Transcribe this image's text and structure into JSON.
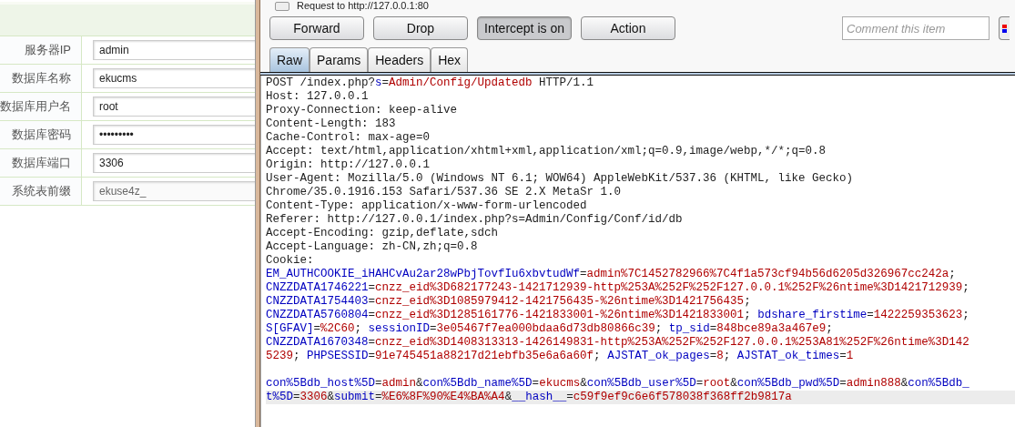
{
  "form": {
    "rows": [
      {
        "label": "服务器IP",
        "value": "admin",
        "disabled": false
      },
      {
        "label": "数据库名称",
        "value": "ekucms",
        "disabled": false
      },
      {
        "label": "数据库用户名",
        "value": "root",
        "disabled": false
      },
      {
        "label": "数据库密码",
        "value": "•••••••••",
        "disabled": false
      },
      {
        "label": "数据库端口",
        "value": "3306",
        "disabled": false
      },
      {
        "label": "系统表前缀",
        "value": "ekuse4z_",
        "disabled": true
      }
    ]
  },
  "proxy": {
    "title": "Request to http://127.0.0.1:80",
    "buttons": [
      {
        "label": "Forward",
        "pressed": false
      },
      {
        "label": "Drop",
        "pressed": false
      },
      {
        "label": "Intercept is on",
        "pressed": true
      },
      {
        "label": "Action",
        "pressed": false
      }
    ],
    "comment": {
      "placeholder": "Comment this item"
    },
    "tabs": [
      {
        "label": "Raw",
        "selected": true
      },
      {
        "label": "Params",
        "selected": false
      },
      {
        "label": "Headers",
        "selected": false
      },
      {
        "label": "Hex",
        "selected": false
      }
    ],
    "lines": [
      {
        "highlighted": false,
        "segments": [
          {
            "text": "POST /index.php?",
            "kind": "plain"
          },
          {
            "text": "s",
            "kind": "key"
          },
          {
            "text": "=",
            "kind": "plain"
          },
          {
            "text": "Admin/Config/Updatedb",
            "kind": "value"
          },
          {
            "text": " HTTP/1.1",
            "kind": "plain"
          }
        ]
      },
      {
        "highlighted": false,
        "segments": [
          {
            "text": "Host: 127.0.0.1",
            "kind": "plain"
          }
        ]
      },
      {
        "highlighted": false,
        "segments": [
          {
            "text": "Proxy-Connection: keep-alive",
            "kind": "plain"
          }
        ]
      },
      {
        "highlighted": false,
        "segments": [
          {
            "text": "Content-Length: 183",
            "kind": "plain"
          }
        ]
      },
      {
        "highlighted": false,
        "segments": [
          {
            "text": "Cache-Control: max-age=0",
            "kind": "plain"
          }
        ]
      },
      {
        "highlighted": false,
        "segments": [
          {
            "text": "Accept: text/html,application/xhtml+xml,application/xml;q=0.9,image/webp,*/*;q=0.8",
            "kind": "plain"
          }
        ]
      },
      {
        "highlighted": false,
        "segments": [
          {
            "text": "Origin: http://127.0.0.1",
            "kind": "plain"
          }
        ]
      },
      {
        "highlighted": false,
        "segments": [
          {
            "text": "User-Agent: Mozilla/5.0 (Windows NT 6.1; WOW64) AppleWebKit/537.36 (KHTML, like Gecko)",
            "kind": "plain"
          }
        ]
      },
      {
        "highlighted": false,
        "segments": [
          {
            "text": "Chrome/35.0.1916.153 Safari/537.36 SE 2.X MetaSr 1.0",
            "kind": "plain"
          }
        ]
      },
      {
        "highlighted": false,
        "segments": [
          {
            "text": "Content-Type: application/x-www-form-urlencoded",
            "kind": "plain"
          }
        ]
      },
      {
        "highlighted": false,
        "segments": [
          {
            "text": "Referer: http://127.0.0.1/index.php?s=Admin/Config/Conf/id/db",
            "kind": "plain"
          }
        ]
      },
      {
        "highlighted": false,
        "segments": [
          {
            "text": "Accept-Encoding: gzip,deflate,sdch",
            "kind": "plain"
          }
        ]
      },
      {
        "highlighted": false,
        "segments": [
          {
            "text": "Accept-Language: zh-CN,zh;q=0.8",
            "kind": "plain"
          }
        ]
      },
      {
        "highlighted": false,
        "segments": [
          {
            "text": "Cookie:",
            "kind": "plain"
          }
        ]
      },
      {
        "highlighted": false,
        "segments": [
          {
            "text": "EM_AUTHCOOKIE_iHAHCvAu2ar28wPbjTovfIu6xbvtudWf",
            "kind": "key"
          },
          {
            "text": "=",
            "kind": "plain"
          },
          {
            "text": "admin%7C1452782966%7C4f1a573cf94b56d6205d326967cc242a",
            "kind": "value"
          },
          {
            "text": ";",
            "kind": "plain"
          }
        ]
      },
      {
        "highlighted": false,
        "segments": [
          {
            "text": "CNZZDATA1746221",
            "kind": "key"
          },
          {
            "text": "=",
            "kind": "plain"
          },
          {
            "text": "cnzz_eid%3D682177243-1421712939-http%253A%252F%252F127.0.0.1%252F%26ntime%3D1421712939",
            "kind": "value"
          },
          {
            "text": ";",
            "kind": "plain"
          }
        ]
      },
      {
        "highlighted": false,
        "segments": [
          {
            "text": "CNZZDATA1754403",
            "kind": "key"
          },
          {
            "text": "=",
            "kind": "plain"
          },
          {
            "text": "cnzz_eid%3D1085979412-1421756435-%26ntime%3D1421756435",
            "kind": "value"
          },
          {
            "text": ";",
            "kind": "plain"
          }
        ]
      },
      {
        "highlighted": false,
        "segments": [
          {
            "text": "CNZZDATA5760804",
            "kind": "key"
          },
          {
            "text": "=",
            "kind": "plain"
          },
          {
            "text": "cnzz_eid%3D1285161776-1421833001-%26ntime%3D1421833001",
            "kind": "value"
          },
          {
            "text": "; ",
            "kind": "plain"
          },
          {
            "text": "bdshare_firstime",
            "kind": "key"
          },
          {
            "text": "=",
            "kind": "plain"
          },
          {
            "text": "1422259353623",
            "kind": "value"
          },
          {
            "text": ";",
            "kind": "plain"
          }
        ]
      },
      {
        "highlighted": false,
        "segments": [
          {
            "text": "S[GFAV]",
            "kind": "key"
          },
          {
            "text": "=",
            "kind": "plain"
          },
          {
            "text": "%2C60",
            "kind": "value"
          },
          {
            "text": "; ",
            "kind": "plain"
          },
          {
            "text": "sessionID",
            "kind": "key"
          },
          {
            "text": "=",
            "kind": "plain"
          },
          {
            "text": "3e05467f7ea000bdaa6d73db80866c39",
            "kind": "value"
          },
          {
            "text": "; ",
            "kind": "plain"
          },
          {
            "text": "tp_sid",
            "kind": "key"
          },
          {
            "text": "=",
            "kind": "plain"
          },
          {
            "text": "848bce89a3a467e9",
            "kind": "value"
          },
          {
            "text": ";",
            "kind": "plain"
          }
        ]
      },
      {
        "highlighted": false,
        "segments": [
          {
            "text": "CNZZDATA1670348",
            "kind": "key"
          },
          {
            "text": "=",
            "kind": "plain"
          },
          {
            "text": "cnzz_eid%3D1408313313-1426149831-http%253A%252F%252F127.0.0.1%253A81%252F%26ntime%3D142",
            "kind": "value"
          }
        ]
      },
      {
        "highlighted": false,
        "segments": [
          {
            "text": "5239",
            "kind": "value"
          },
          {
            "text": "; ",
            "kind": "plain"
          },
          {
            "text": "PHPSESSID",
            "kind": "key"
          },
          {
            "text": "=",
            "kind": "plain"
          },
          {
            "text": "91e745451a88217d21ebfb35e6a6a60f",
            "kind": "value"
          },
          {
            "text": "; ",
            "kind": "plain"
          },
          {
            "text": "AJSTAT_ok_pages",
            "kind": "key"
          },
          {
            "text": "=",
            "kind": "plain"
          },
          {
            "text": "8",
            "kind": "value"
          },
          {
            "text": "; ",
            "kind": "plain"
          },
          {
            "text": "AJSTAT_ok_times",
            "kind": "key"
          },
          {
            "text": "=",
            "kind": "plain"
          },
          {
            "text": "1",
            "kind": "value"
          }
        ]
      },
      {
        "highlighted": false
      },
      {
        "highlighted": false,
        "segments": [
          {
            "text": "con%5Bdb_host%5D",
            "kind": "key"
          },
          {
            "text": "=",
            "kind": "plain"
          },
          {
            "text": "admin",
            "kind": "value"
          },
          {
            "text": "&",
            "kind": "plain"
          },
          {
            "text": "con%5Bdb_name%5D",
            "kind": "key"
          },
          {
            "text": "=",
            "kind": "plain"
          },
          {
            "text": "ekucms",
            "kind": "value"
          },
          {
            "text": "&",
            "kind": "plain"
          },
          {
            "text": "con%5Bdb_user%5D",
            "kind": "key"
          },
          {
            "text": "=",
            "kind": "plain"
          },
          {
            "text": "root",
            "kind": "value"
          },
          {
            "text": "&",
            "kind": "plain"
          },
          {
            "text": "con%5Bdb_pwd%5D",
            "kind": "key"
          },
          {
            "text": "=",
            "kind": "plain"
          },
          {
            "text": "admin888",
            "kind": "value"
          },
          {
            "text": "&",
            "kind": "plain"
          },
          {
            "text": "con%5Bdb_",
            "kind": "key"
          }
        ]
      },
      {
        "highlighted": true,
        "segments": [
          {
            "text": "t%5D",
            "kind": "key"
          },
          {
            "text": "=",
            "kind": "plain"
          },
          {
            "text": "3306",
            "kind": "value"
          },
          {
            "text": "&",
            "kind": "plain"
          },
          {
            "text": "submit",
            "kind": "key"
          },
          {
            "text": "=",
            "kind": "plain"
          },
          {
            "text": "%E6%8F%90%E4%BA%A4",
            "kind": "value"
          },
          {
            "text": "&",
            "kind": "plain"
          },
          {
            "text": "__hash__",
            "kind": "key"
          },
          {
            "text": "=",
            "kind": "plain"
          },
          {
            "text": "c59f9ef9c6e6f578038f368ff2b9817a",
            "kind": "value"
          }
        ]
      }
    ]
  }
}
